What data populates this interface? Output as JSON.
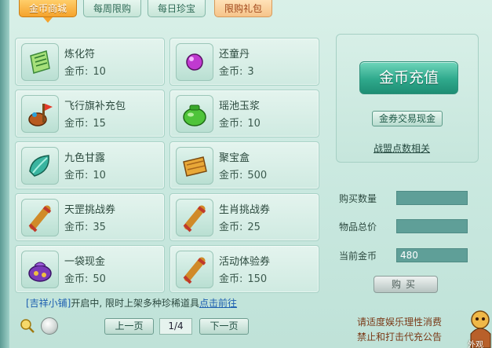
{
  "tabs": [
    {
      "label": "金币商城",
      "state": "active"
    },
    {
      "label": "每周限购",
      "state": "normal"
    },
    {
      "label": "每日珍宝",
      "state": "normal"
    },
    {
      "label": "限购礼包",
      "state": "gift"
    }
  ],
  "items": [
    {
      "name": "炼化符",
      "price_label": "金币:",
      "price": "10",
      "icon": "talisman-icon"
    },
    {
      "name": "还童丹",
      "price_label": "金币:",
      "price": "3",
      "icon": "purple-pill-icon"
    },
    {
      "name": "飞行旗补充包",
      "price_label": "金币:",
      "price": "15",
      "icon": "flag-pouch-icon"
    },
    {
      "name": "瑶池玉浆",
      "price_label": "金币:",
      "price": "10",
      "icon": "jade-pot-icon"
    },
    {
      "name": "九色甘露",
      "price_label": "金币:",
      "price": "10",
      "icon": "leaf-icon"
    },
    {
      "name": "聚宝盒",
      "price_label": "金币:",
      "price": "500",
      "icon": "treasure-box-icon"
    },
    {
      "name": "天罡挑战券",
      "price_label": "金币:",
      "price": "35",
      "icon": "scroll-icon"
    },
    {
      "name": "生肖挑战券",
      "price_label": "金币:",
      "price": "25",
      "icon": "scroll-icon"
    },
    {
      "name": "一袋现金",
      "price_label": "金币:",
      "price": "50",
      "icon": "money-bag-icon"
    },
    {
      "name": "活动体验券",
      "price_label": "金币:",
      "price": "150",
      "icon": "scroll-icon"
    }
  ],
  "right": {
    "recharge_label": "金币充值",
    "exchange_label": "金券交易现金",
    "alliance_link": "战盟点数相关"
  },
  "form": {
    "quantity_label": "购买数量",
    "quantity_value": "",
    "total_label": "物品总价",
    "total_value": "",
    "balance_label": "当前金币",
    "balance_value": "480",
    "buy_label": "购买"
  },
  "notice": {
    "shop_name": "[吉祥小铺]",
    "text": "开启中, 限时上架多种珍稀道具",
    "link": "点击前往"
  },
  "pager": {
    "prev_label": "上一页",
    "page": "1/4",
    "next_label": "下一页"
  },
  "footer": {
    "line1": "请适度娱乐理性消费",
    "line2": "禁止和打击代充公告"
  },
  "corner_label": "外观",
  "colors": {
    "accent_orange": "#f5a32c",
    "recharge_green": "#2fa98c",
    "link_blue": "#1d5fb0"
  }
}
